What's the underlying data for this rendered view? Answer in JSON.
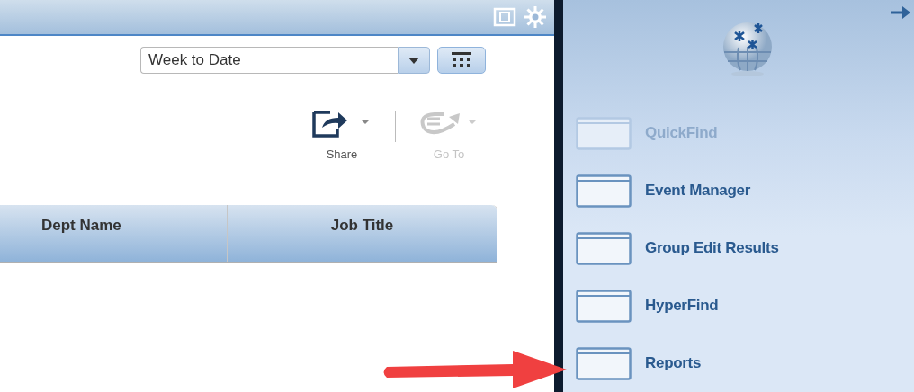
{
  "period_select": {
    "value": "Week to Date"
  },
  "actions": [
    {
      "label": "Share",
      "kind": "share",
      "disabled": false
    },
    {
      "label": "Go To",
      "kind": "goto",
      "disabled": true
    }
  ],
  "table": {
    "columns": [
      "Dept Name",
      "Job Title"
    ]
  },
  "sidebar": {
    "items": [
      {
        "label": "QuickFind",
        "disabled": true
      },
      {
        "label": "Event Manager",
        "disabled": false
      },
      {
        "label": "Group Edit Results",
        "disabled": false
      },
      {
        "label": "HyperFind",
        "disabled": false
      },
      {
        "label": "Reports",
        "disabled": false
      }
    ]
  }
}
